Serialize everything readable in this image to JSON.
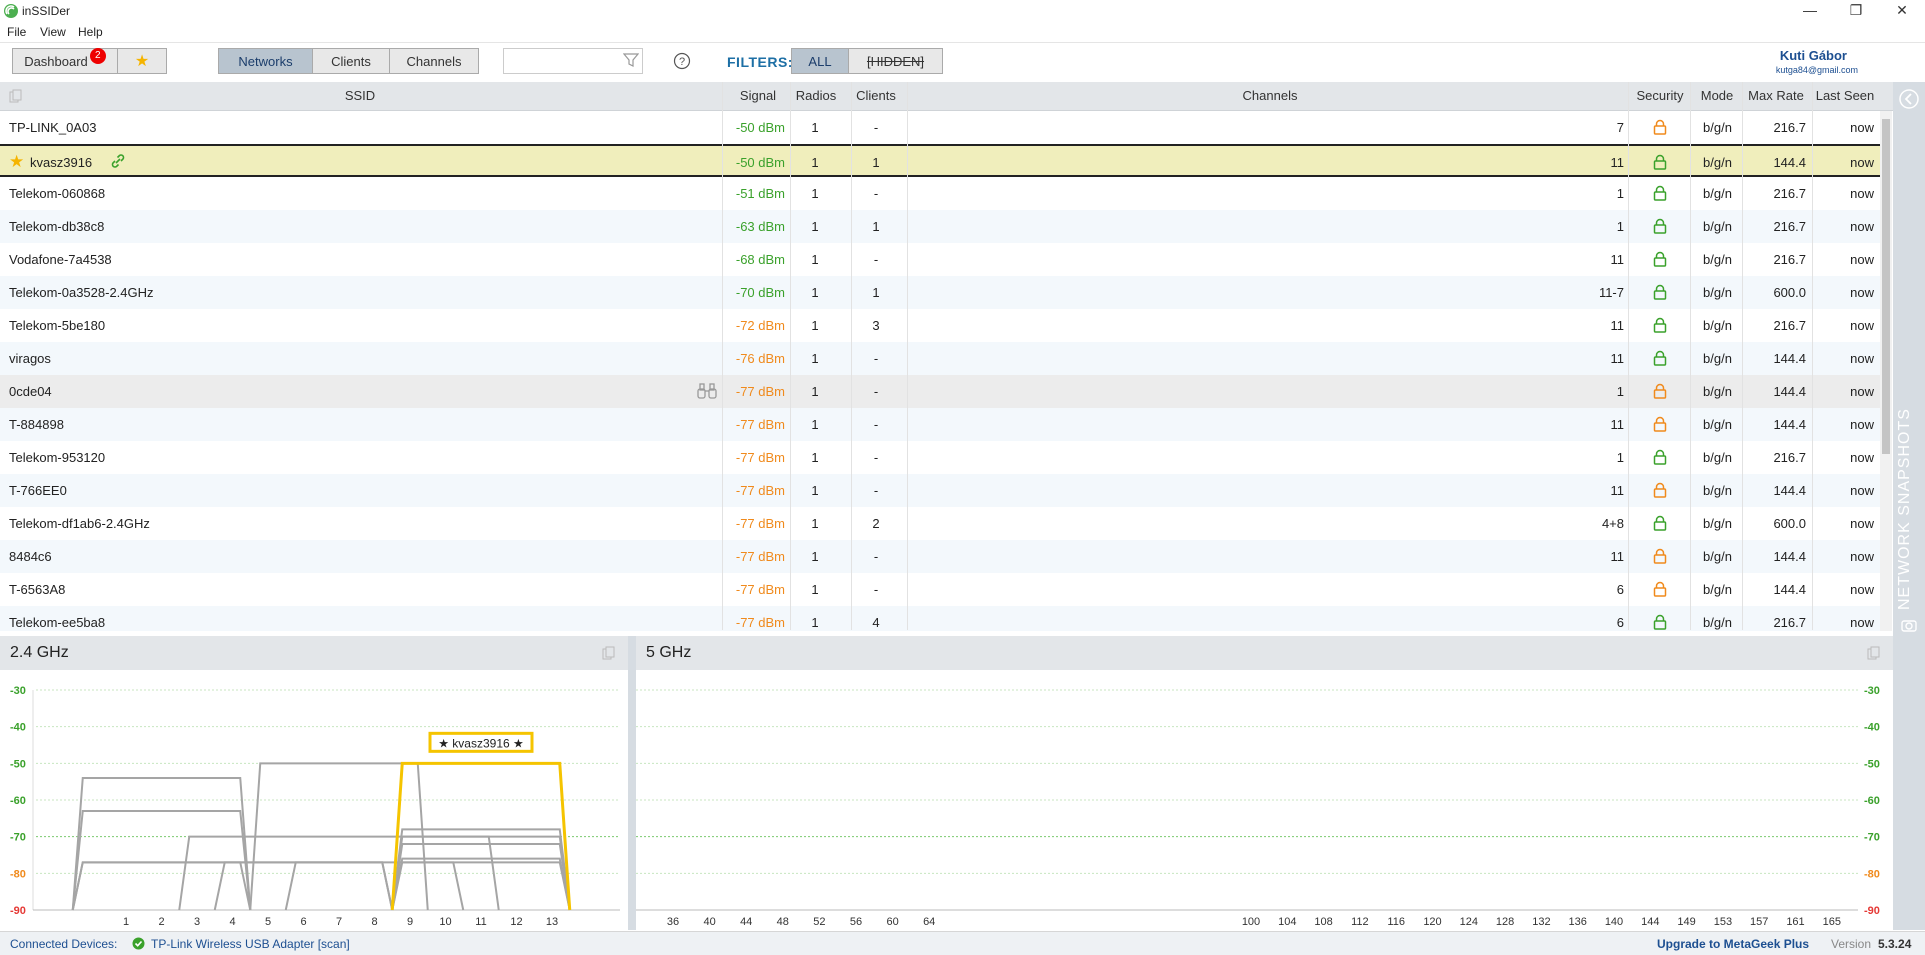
{
  "app": {
    "title": "inSSIDer",
    "version_label": "Version",
    "version": "5.3.24"
  },
  "window_controls": {
    "minimize": "—",
    "maximize": "❐",
    "close": "✕"
  },
  "menu": [
    "File",
    "View",
    "Help"
  ],
  "toolbar": {
    "dashboard_label": "Dashboard",
    "dashboard_badge": "2",
    "favorites_icon": "star-icon",
    "tabs": [
      "Networks",
      "Clients",
      "Channels"
    ],
    "search_placeholder": "",
    "filters_label": "FILTERS:",
    "filter_all": "ALL",
    "filter_hidden": "[HIDDEN]"
  },
  "user": {
    "name": "Kuti Gábor",
    "email": "kutga84@gmail.com"
  },
  "columns": {
    "ssid": "SSID",
    "signal": "Signal",
    "radios": "Radios",
    "clients": "Clients",
    "channels": "Channels",
    "security": "Security",
    "mode": "Mode",
    "max_rate": "Max Rate",
    "last_seen": "Last Seen"
  },
  "networks": [
    {
      "ssid": "TP-LINK_0A03",
      "signal": "-50 dBm",
      "radios": "1",
      "clients": "-",
      "channels": "7",
      "security": "orange",
      "mode": "b/g/n",
      "rate": "216.7",
      "seen": "now"
    },
    {
      "ssid": "kvasz3916",
      "signal": "-50 dBm",
      "radios": "1",
      "clients": "1",
      "channels": "11",
      "security": "green",
      "mode": "b/g/n",
      "rate": "144.4",
      "seen": "now",
      "selected": true
    },
    {
      "ssid": "Telekom-060868",
      "signal": "-51 dBm",
      "radios": "1",
      "clients": "-",
      "channels": "1",
      "security": "green",
      "mode": "b/g/n",
      "rate": "216.7",
      "seen": "now"
    },
    {
      "ssid": "Telekom-db38c8",
      "signal": "-63 dBm",
      "radios": "1",
      "clients": "1",
      "channels": "1",
      "security": "green",
      "mode": "b/g/n",
      "rate": "216.7",
      "seen": "now"
    },
    {
      "ssid": "Vodafone-7a4538",
      "signal": "-68 dBm",
      "radios": "1",
      "clients": "-",
      "channels": "11",
      "security": "green",
      "mode": "b/g/n",
      "rate": "216.7",
      "seen": "now"
    },
    {
      "ssid": "Telekom-0a3528-2.4GHz",
      "signal": "-70 dBm",
      "radios": "1",
      "clients": "1",
      "channels": "11-7",
      "security": "green",
      "mode": "b/g/n",
      "rate": "600.0",
      "seen": "now"
    },
    {
      "ssid": "Telekom-5be180",
      "signal": "-72 dBm",
      "radios": "1",
      "clients": "3",
      "channels": "11",
      "security": "green",
      "mode": "b/g/n",
      "rate": "216.7",
      "seen": "now"
    },
    {
      "ssid": "viragos",
      "signal": "-76 dBm",
      "radios": "1",
      "clients": "-",
      "channels": "11",
      "security": "green",
      "mode": "b/g/n",
      "rate": "144.4",
      "seen": "now"
    },
    {
      "ssid": "0cde04",
      "signal": "-77 dBm",
      "radios": "1",
      "clients": "-",
      "channels": "1",
      "security": "orange",
      "mode": "b/g/n",
      "rate": "144.4",
      "seen": "now",
      "hover": true
    },
    {
      "ssid": "T-884898",
      "signal": "-77 dBm",
      "radios": "1",
      "clients": "-",
      "channels": "11",
      "security": "orange",
      "mode": "b/g/n",
      "rate": "144.4",
      "seen": "now"
    },
    {
      "ssid": "Telekom-953120",
      "signal": "-77 dBm",
      "radios": "1",
      "clients": "-",
      "channels": "1",
      "security": "green",
      "mode": "b/g/n",
      "rate": "216.7",
      "seen": "now"
    },
    {
      "ssid": "T-766EE0",
      "signal": "-77 dBm",
      "radios": "1",
      "clients": "-",
      "channels": "11",
      "security": "orange",
      "mode": "b/g/n",
      "rate": "144.4",
      "seen": "now"
    },
    {
      "ssid": "Telekom-df1ab6-2.4GHz",
      "signal": "-77 dBm",
      "radios": "1",
      "clients": "2",
      "channels": "4+8",
      "security": "green",
      "mode": "b/g/n",
      "rate": "600.0",
      "seen": "now"
    },
    {
      "ssid": "8484c6",
      "signal": "-77 dBm",
      "radios": "1",
      "clients": "-",
      "channels": "11",
      "security": "orange",
      "mode": "b/g/n",
      "rate": "144.4",
      "seen": "now"
    },
    {
      "ssid": "T-6563A8",
      "signal": "-77 dBm",
      "radios": "1",
      "clients": "-",
      "channels": "6",
      "security": "orange",
      "mode": "b/g/n",
      "rate": "144.4",
      "seen": "now"
    },
    {
      "ssid": "Telekom-ee5ba8",
      "signal": "-77 dBm",
      "radios": "1",
      "clients": "4",
      "channels": "6",
      "security": "green",
      "mode": "b/g/n",
      "rate": "216.7",
      "seen": "now"
    }
  ],
  "side_panel": {
    "label": "NETWORK SNAPSHOTS"
  },
  "chart_data": [
    {
      "type": "area",
      "title": "2.4 GHz",
      "ylim": [
        -90,
        -30
      ],
      "y_ticks": [
        -30,
        -40,
        -50,
        -60,
        -70,
        -80,
        -90
      ],
      "x_ticks": [
        1,
        2,
        3,
        4,
        5,
        6,
        7,
        8,
        9,
        10,
        11,
        12,
        13
      ],
      "highlight_label": "★ kvasz3916 ★",
      "series": [
        {
          "channel": 2,
          "width": 4,
          "signal": -54
        },
        {
          "channel": 2,
          "width": 4,
          "signal": -63
        },
        {
          "channel": 2,
          "width": 4,
          "signal": -77
        },
        {
          "channel": 4,
          "width": 8,
          "signal": -77
        },
        {
          "channel": 6,
          "width": 4,
          "signal": -77
        },
        {
          "channel": 7,
          "width": 4,
          "signal": -50
        },
        {
          "channel": 8,
          "width": 4,
          "signal": -77
        },
        {
          "channel": 7,
          "width": 8,
          "signal": -70
        },
        {
          "channel": 11,
          "width": 4,
          "signal": -68
        },
        {
          "channel": 11,
          "width": 4,
          "signal": -70
        },
        {
          "channel": 11,
          "width": 4,
          "signal": -72
        },
        {
          "channel": 11,
          "width": 4,
          "signal": -76
        },
        {
          "channel": 11,
          "width": 4,
          "signal": -77
        },
        {
          "channel": 11,
          "width": 4,
          "signal": -50,
          "highlight": true
        }
      ]
    },
    {
      "type": "area",
      "title": "5 GHz",
      "ylim": [
        -90,
        -30
      ],
      "y_ticks": [
        -30,
        -40,
        -50,
        -60,
        -70,
        -80,
        -90
      ],
      "x_ticks": [
        36,
        40,
        44,
        48,
        52,
        56,
        60,
        64,
        100,
        104,
        108,
        112,
        116,
        120,
        124,
        128,
        132,
        136,
        140,
        144,
        149,
        153,
        157,
        161,
        165
      ],
      "series": []
    }
  ],
  "status": {
    "connected_label": "Connected Devices:",
    "adapter": "TP-Link Wireless USB Adapter [scan]",
    "upgrade": "Upgrade to MetaGeek Plus"
  },
  "colors": {
    "green": "#3aa12b",
    "orange": "#f08a1c",
    "highlight": "#f5c400",
    "accent": "#1d6fa5"
  }
}
